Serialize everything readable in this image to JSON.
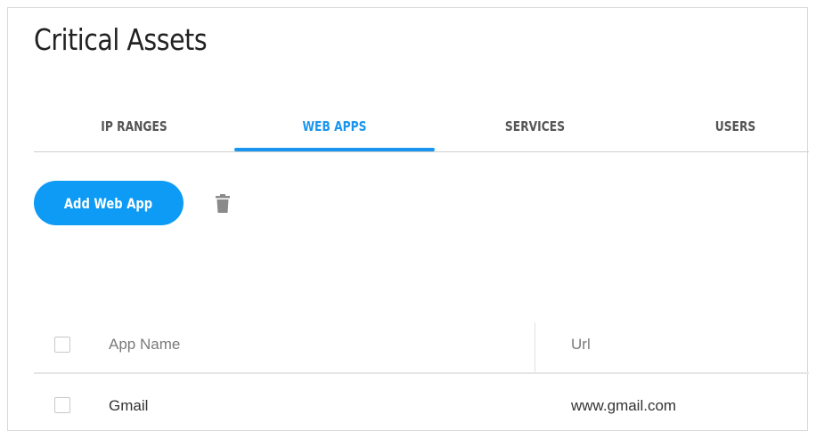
{
  "page": {
    "title": "Critical Assets"
  },
  "tabs": [
    {
      "label": "IP RANGES",
      "active": false
    },
    {
      "label": "WEB APPS",
      "active": true
    },
    {
      "label": "SERVICES",
      "active": false
    },
    {
      "label": "USERS",
      "active": false
    }
  ],
  "toolbar": {
    "add_label": "Add Web App",
    "delete_icon": "trash-icon"
  },
  "table": {
    "columns": [
      "App Name",
      "Url"
    ],
    "rows": [
      {
        "app_name": "Gmail",
        "url": "www.gmail.com",
        "checked": false
      }
    ]
  },
  "colors": {
    "accent": "#1a96f0",
    "button": "#0d9bf5",
    "text": "#333333",
    "muted": "#7a7a7a"
  }
}
